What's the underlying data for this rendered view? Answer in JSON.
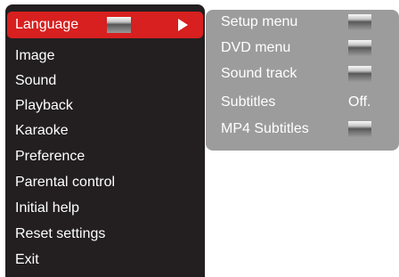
{
  "main_menu": {
    "items": [
      {
        "label": "Language"
      },
      {
        "label": "Image"
      },
      {
        "label": "Sound"
      },
      {
        "label": "Playback"
      },
      {
        "label": "Karaoke"
      },
      {
        "label": "Preference"
      },
      {
        "label": "Parental control"
      },
      {
        "label": "Initial help"
      },
      {
        "label": "Reset settings"
      },
      {
        "label": "Exit"
      }
    ],
    "selected": "Language",
    "selected_arrow_icon": "triangle-right-icon"
  },
  "submenu": {
    "items": [
      {
        "label": "Setup menu"
      },
      {
        "label": "DVD menu"
      },
      {
        "label": "Sound track"
      },
      {
        "label": "Subtitles",
        "value": "Off."
      },
      {
        "label": "MP4 Subtitles"
      }
    ]
  },
  "colors": {
    "menu_background": "#231f20",
    "selected_background": "#d7201f",
    "submenu_background": "#9d9c9c",
    "text": "#ffffff"
  }
}
